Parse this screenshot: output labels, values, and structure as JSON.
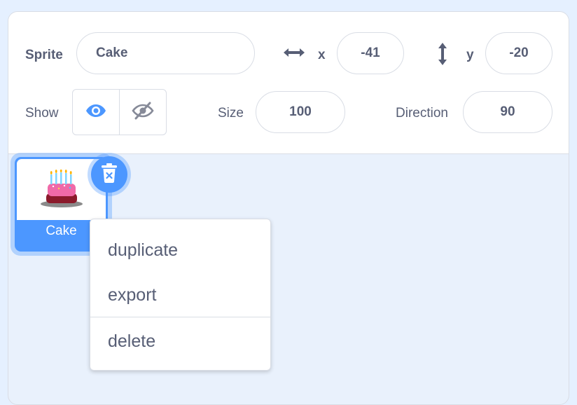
{
  "sprite_info": {
    "sprite_label": "Sprite",
    "sprite_name": "Cake",
    "x_label": "x",
    "x_value": "-41",
    "y_label": "y",
    "y_value": "-20",
    "show_label": "Show",
    "size_label": "Size",
    "size_value": "100",
    "direction_label": "Direction",
    "direction_value": "90",
    "visible": true
  },
  "sprite_list": {
    "items": [
      {
        "name": "Cake",
        "selected": true
      }
    ]
  },
  "context_menu": {
    "items": [
      "duplicate",
      "export",
      "delete"
    ]
  },
  "colors": {
    "accent": "#4c97ff",
    "text": "#575e75",
    "border": "#d9dde5",
    "background": "#e9f1fc"
  },
  "icons": {
    "x_axis": "horizontal-arrow-icon",
    "y_axis": "vertical-arrow-icon",
    "show": "eye-icon",
    "hide": "eye-slash-icon",
    "delete": "trash-icon",
    "thumbnail": "cake-costume-icon"
  }
}
